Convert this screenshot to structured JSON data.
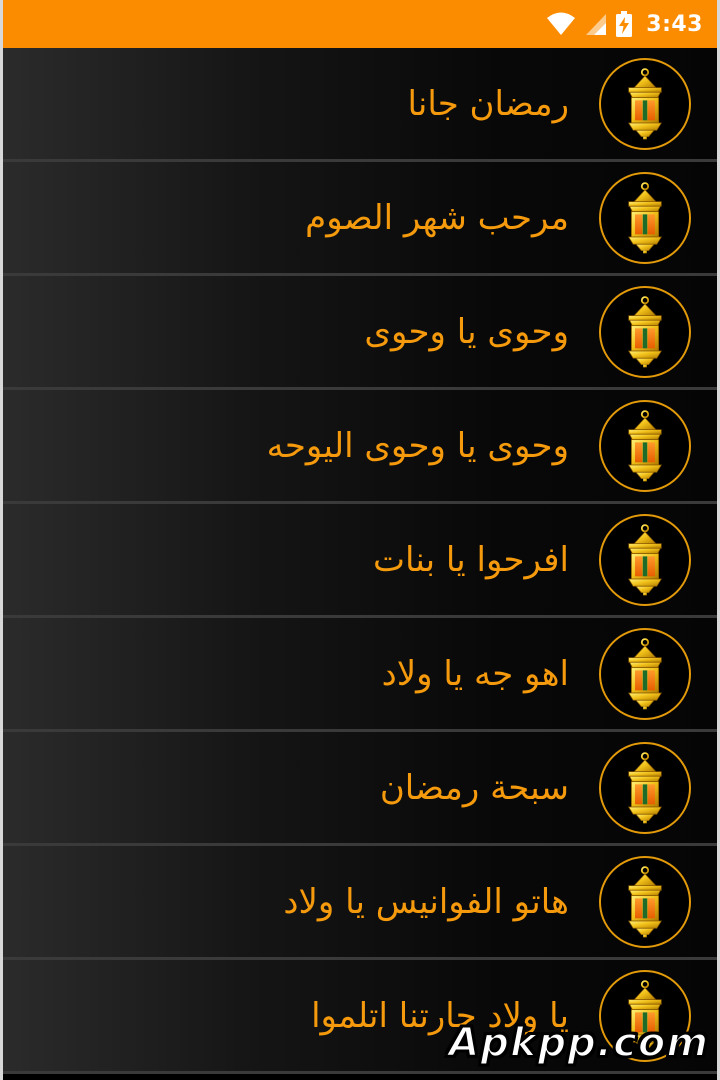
{
  "status_bar": {
    "time": "3:43",
    "background_color": "#fb8c00",
    "icons": [
      "wifi-icon",
      "signal-icon",
      "battery-charging-icon"
    ]
  },
  "list": {
    "text_color": "#f59a0c",
    "item_icon": "lantern-icon",
    "items": [
      {
        "label": "رمضان جانا"
      },
      {
        "label": "مرحب شهر الصوم"
      },
      {
        "label": "وحوى يا وحوى"
      },
      {
        "label": "وحوى يا وحوى اليوحه"
      },
      {
        "label": "افرحوا يا بنات"
      },
      {
        "label": "اهو جه يا ولاد"
      },
      {
        "label": "سبحة رمضان"
      },
      {
        "label": "هاتو الفوانيس يا ولاد"
      },
      {
        "label": "يا ولاد حارتنا اتلموا"
      }
    ]
  },
  "watermark": {
    "text": "Apkpp.com"
  }
}
